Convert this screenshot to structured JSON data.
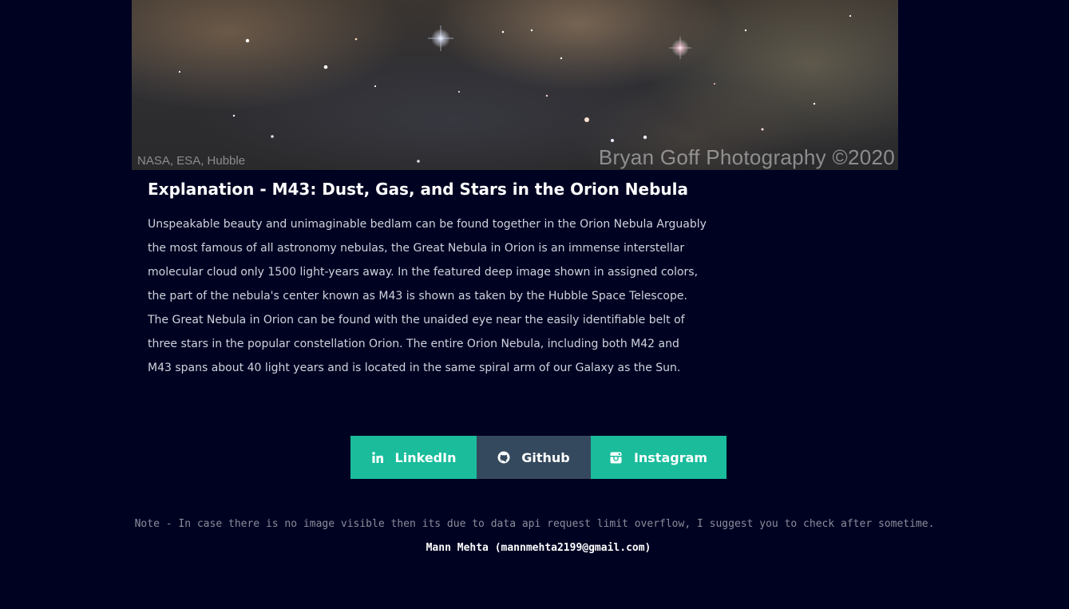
{
  "hero_image": {
    "credit_left": "NASA, ESA, Hubble",
    "credit_right": "Bryan Goff Photography ©2020"
  },
  "explanation": {
    "title": "Explanation - M43: Dust, Gas, and Stars in the Orion Nebula",
    "body": "Unspeakable beauty and unimaginable bedlam can be found together in the Orion Nebula Arguably the most famous of all astronomy nebulas, the Great Nebula in Orion is an immense interstellar molecular cloud only 1500 light-years away. In the featured deep image shown in assigned colors, the part of the nebula's center known as M43 is shown as taken by the Hubble Space Telescope. The Great Nebula in Orion can be found with the unaided eye near the easily identifiable belt of three stars in the popular constellation Orion. The entire Orion Nebula, including both M42 and M43 spans about 40 light years and is located in the same spiral arm of our Galaxy as the Sun."
  },
  "social": {
    "linkedin": {
      "label": "LinkedIn",
      "icon": "linkedin-icon",
      "color": "#1abc9c"
    },
    "github": {
      "label": "Github",
      "icon": "github-icon",
      "color": "#34495e"
    },
    "instagram": {
      "label": "Instagram",
      "icon": "instagram-icon",
      "color": "#1abc9c"
    }
  },
  "footer": {
    "note": "Note - In case there is no image visible then its due to data api request limit overflow, I suggest you to check after sometime.",
    "author": "Mann Mehta (mannmehta2199@gmail.com)"
  },
  "colors": {
    "background": "#000222",
    "accent": "#1abc9c",
    "github": "#34495e"
  }
}
